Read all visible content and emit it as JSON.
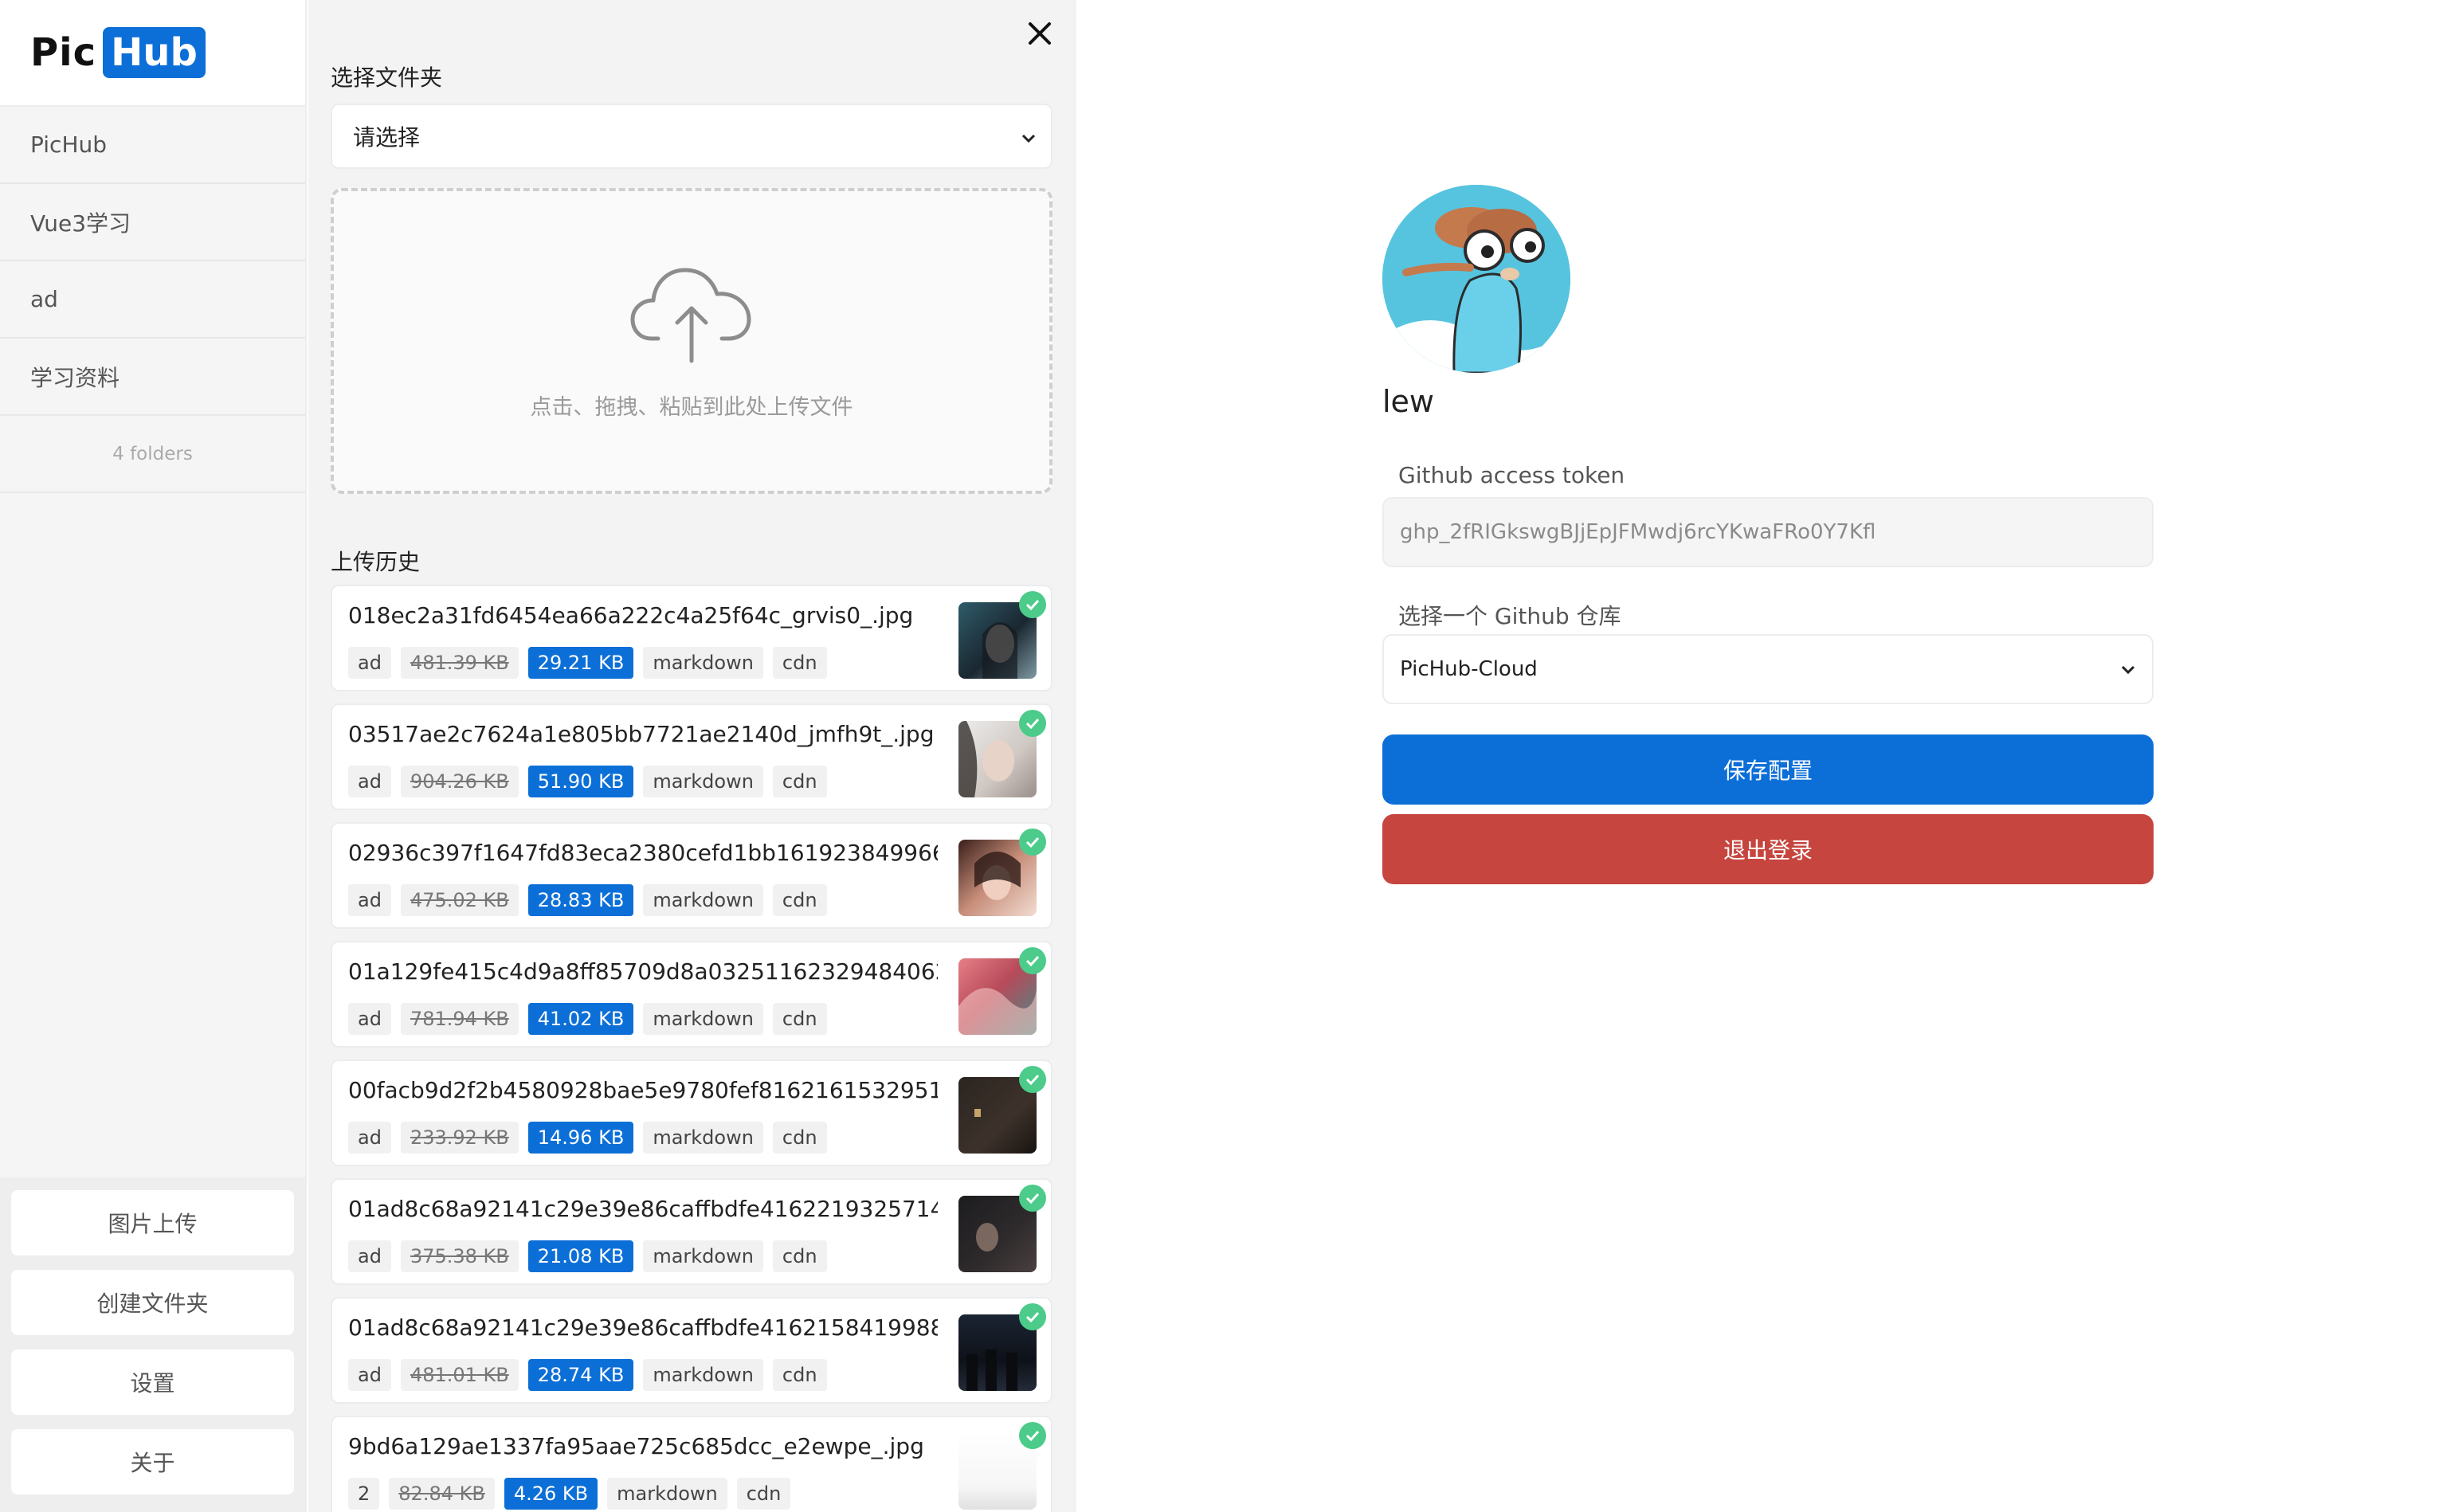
{
  "sidebar": {
    "logo": {
      "pic": "Pic",
      "hub": "Hub"
    },
    "folders": [
      "PicHub",
      "Vue3学习",
      "ad",
      "学习资料"
    ],
    "folder_count": "4 folders",
    "bottom_buttons": [
      "图片上传",
      "创建文件夹",
      "设置",
      "关于"
    ]
  },
  "upload": {
    "folder_label": "选择文件夹",
    "folder_select_value": "请选择",
    "dropzone_text": "点击、拖拽、粘贴到此处上传文件",
    "history_label": "上传历史",
    "items": [
      {
        "name": "018ec2a31fd6454ea66a222c4a25f64c_grvis0_.jpg",
        "folder": "ad",
        "original_size": "481.39 KB",
        "compressed_size": "29.21 KB",
        "tag_markdown": "markdown",
        "tag_cdn": "cdn"
      },
      {
        "name": "03517ae2c7624a1e805bb7721ae2140d_jmfh9t_.jpg",
        "folder": "ad",
        "original_size": "904.26 KB",
        "compressed_size": "51.90 KB",
        "tag_markdown": "markdown",
        "tag_cdn": "cdn"
      },
      {
        "name": "02936c397f1647fd83eca2380cefd1bb161923849966...",
        "folder": "ad",
        "original_size": "475.02 KB",
        "compressed_size": "28.83 KB",
        "tag_markdown": "markdown",
        "tag_cdn": "cdn"
      },
      {
        "name": "01a129fe415c4d9a8ff85709d8a03251162329484062...",
        "folder": "ad",
        "original_size": "781.94 KB",
        "compressed_size": "41.02 KB",
        "tag_markdown": "markdown",
        "tag_cdn": "cdn"
      },
      {
        "name": "00facb9d2f2b4580928bae5e9780fef81621615329514...",
        "folder": "ad",
        "original_size": "233.92 KB",
        "compressed_size": "14.96 KB",
        "tag_markdown": "markdown",
        "tag_cdn": "cdn"
      },
      {
        "name": "01ad8c68a92141c29e39e86caffbdfe41622193257140...",
        "folder": "ad",
        "original_size": "375.38 KB",
        "compressed_size": "21.08 KB",
        "tag_markdown": "markdown",
        "tag_cdn": "cdn"
      },
      {
        "name": "01ad8c68a92141c29e39e86caffbdfe41621584199888...",
        "folder": "ad",
        "original_size": "481.01 KB",
        "compressed_size": "28.74 KB",
        "tag_markdown": "markdown",
        "tag_cdn": "cdn"
      },
      {
        "name": "9bd6a129ae1337fa95aae725c685dcc_e2ewpe_.jpg",
        "folder": "2",
        "original_size": "82.84 KB",
        "compressed_size": "4.26 KB",
        "tag_markdown": "markdown",
        "tag_cdn": "cdn"
      }
    ]
  },
  "config": {
    "username": "lew",
    "token_label": "Github access token",
    "token_value": "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",
    "repo_label": "选择一个 Github 仓库",
    "repo_value": "PicHub-Cloud",
    "save_label": "保存配置",
    "logout_label": "退出登录"
  },
  "colors": {
    "accent": "#0c6fd7",
    "danger": "#c6453e",
    "success": "#4ccb8a"
  },
  "icons": [
    "close-icon",
    "chevron-down-icon",
    "cloud-upload-icon",
    "check-circle-icon",
    "gopher-avatar"
  ]
}
